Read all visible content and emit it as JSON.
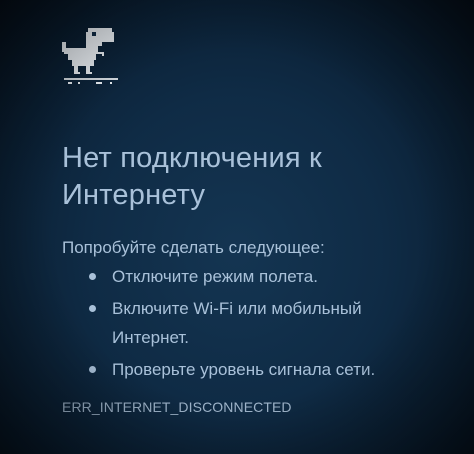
{
  "error_page": {
    "icon": "offline-dino-icon",
    "title": "Нет подключения к Интернету",
    "intro": "Попробуйте сделать следующее:",
    "suggestions": [
      "Отключите режим полета.",
      "Включите Wi-Fi или мобильный Интернет.",
      "Проверьте уровень сигнала сети."
    ],
    "error_code": "ERR_INTERNET_DISCONNECTED"
  },
  "colors": {
    "background": "#0f2b45",
    "text": "#a9c1d9",
    "dino": "#e8edf2"
  }
}
